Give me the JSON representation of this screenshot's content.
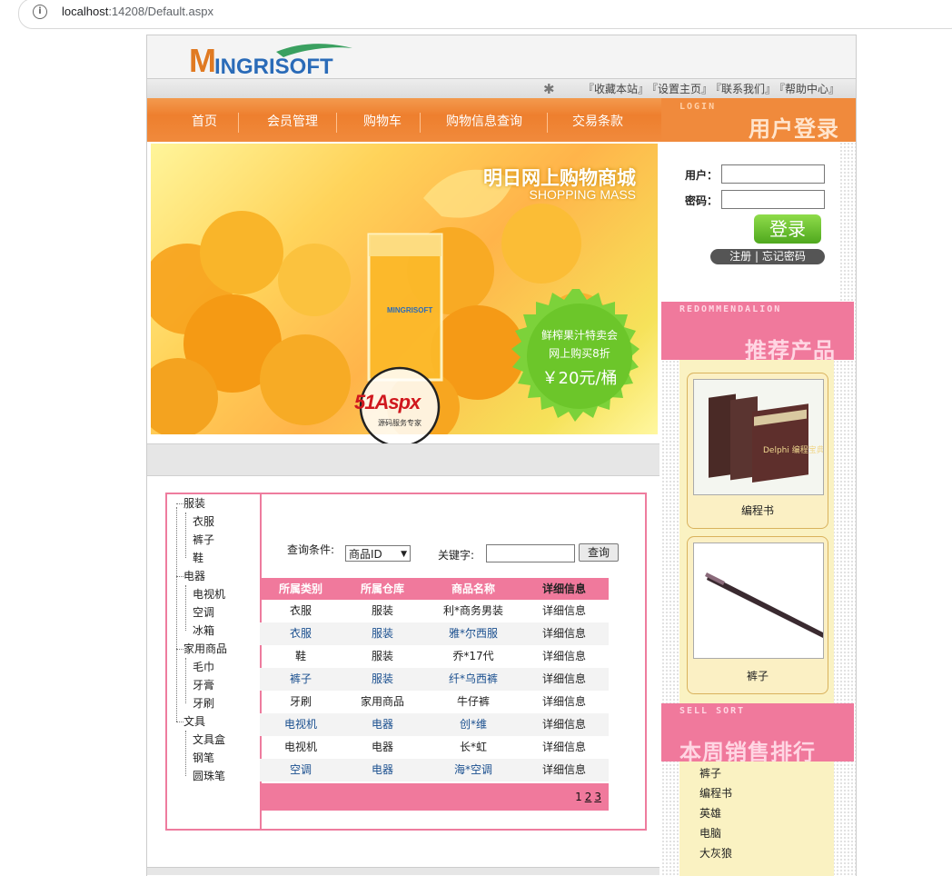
{
  "browser": {
    "url_host": "localhost",
    "url_rest": ":14208/Default.aspx"
  },
  "header": {
    "logo_text": "INGRISOFT",
    "logo_initial": "M",
    "top_links": [
      "『收藏本站』",
      "『设置主页』",
      "『联系我们』",
      "『帮助中心』"
    ]
  },
  "nav": {
    "items": [
      "首页",
      "会员管理",
      "购物车",
      "购物信息查询",
      "交易条款"
    ]
  },
  "banner": {
    "title": "明日网上购物商城",
    "subtitle": "SHOPPING MASS",
    "glass_logo": "MINGRISOFT",
    "promo_line1": "鲜榨果汁特卖会",
    "promo_line2": "网上购买8折",
    "promo_price": "￥20元/桶",
    "watermark": "51Aspx",
    "watermark_sub": "源码服务专家"
  },
  "category_tree": [
    {
      "label": "服装",
      "children": [
        "衣服",
        "裤子",
        "鞋"
      ]
    },
    {
      "label": "电器",
      "children": [
        "电视机",
        "空调",
        "冰箱"
      ]
    },
    {
      "label": "家用商品",
      "children": [
        "毛巾",
        "牙膏",
        "牙刷"
      ]
    },
    {
      "label": "文具",
      "children": [
        "文具盒",
        "钢笔",
        "圆珠笔"
      ]
    }
  ],
  "search": {
    "condition_label": "查询条件:",
    "condition_value": "商品ID",
    "keyword_label": "关键字:",
    "keyword_value": "",
    "button": "查询"
  },
  "product_table": {
    "columns": [
      "所属类别",
      "所属仓库",
      "商品名称",
      "详细信息"
    ],
    "rows": [
      [
        "衣服",
        "服装",
        "利*商务男装",
        "详细信息"
      ],
      [
        "衣服",
        "服装",
        "雅*尔西服",
        "详细信息"
      ],
      [
        "鞋",
        "服装",
        "乔*17代",
        "详细信息"
      ],
      [
        "裤子",
        "服装",
        "纤*乌西裤",
        "详细信息"
      ],
      [
        "牙刷",
        "家用商品",
        "牛仔裤",
        "详细信息"
      ],
      [
        "电视机",
        "电器",
        "创*维",
        "详细信息"
      ],
      [
        "电视机",
        "电器",
        "长*虹",
        "详细信息"
      ],
      [
        "空调",
        "电器",
        "海*空调",
        "详细信息"
      ]
    ],
    "pages": [
      "1",
      "2",
      "3"
    ]
  },
  "login": {
    "header_en": "LOGIN",
    "header_cn": "用户登录",
    "user_label": "用户：",
    "pass_label": "密码：",
    "user_value": "",
    "pass_value": "",
    "login_button": "登录",
    "register": "注册",
    "divider": "|",
    "forgot": "忘记密码"
  },
  "recommend": {
    "header_en": "REDOMMENDALION",
    "header_cn": "推荐产品",
    "items": [
      {
        "name": "编程书",
        "book_title": "Delphi\n编程宝典"
      },
      {
        "name": "裤子"
      }
    ]
  },
  "sell": {
    "header_en": "SELL SORT",
    "header_cn": "本周销售排行",
    "items": [
      "裤子",
      "编程书",
      "英雄",
      "电脑",
      "大灰狼"
    ]
  },
  "colors": {
    "nav_orange": "#ee7f2e",
    "pink": "#f0799c",
    "cream": "#faf2c2"
  }
}
